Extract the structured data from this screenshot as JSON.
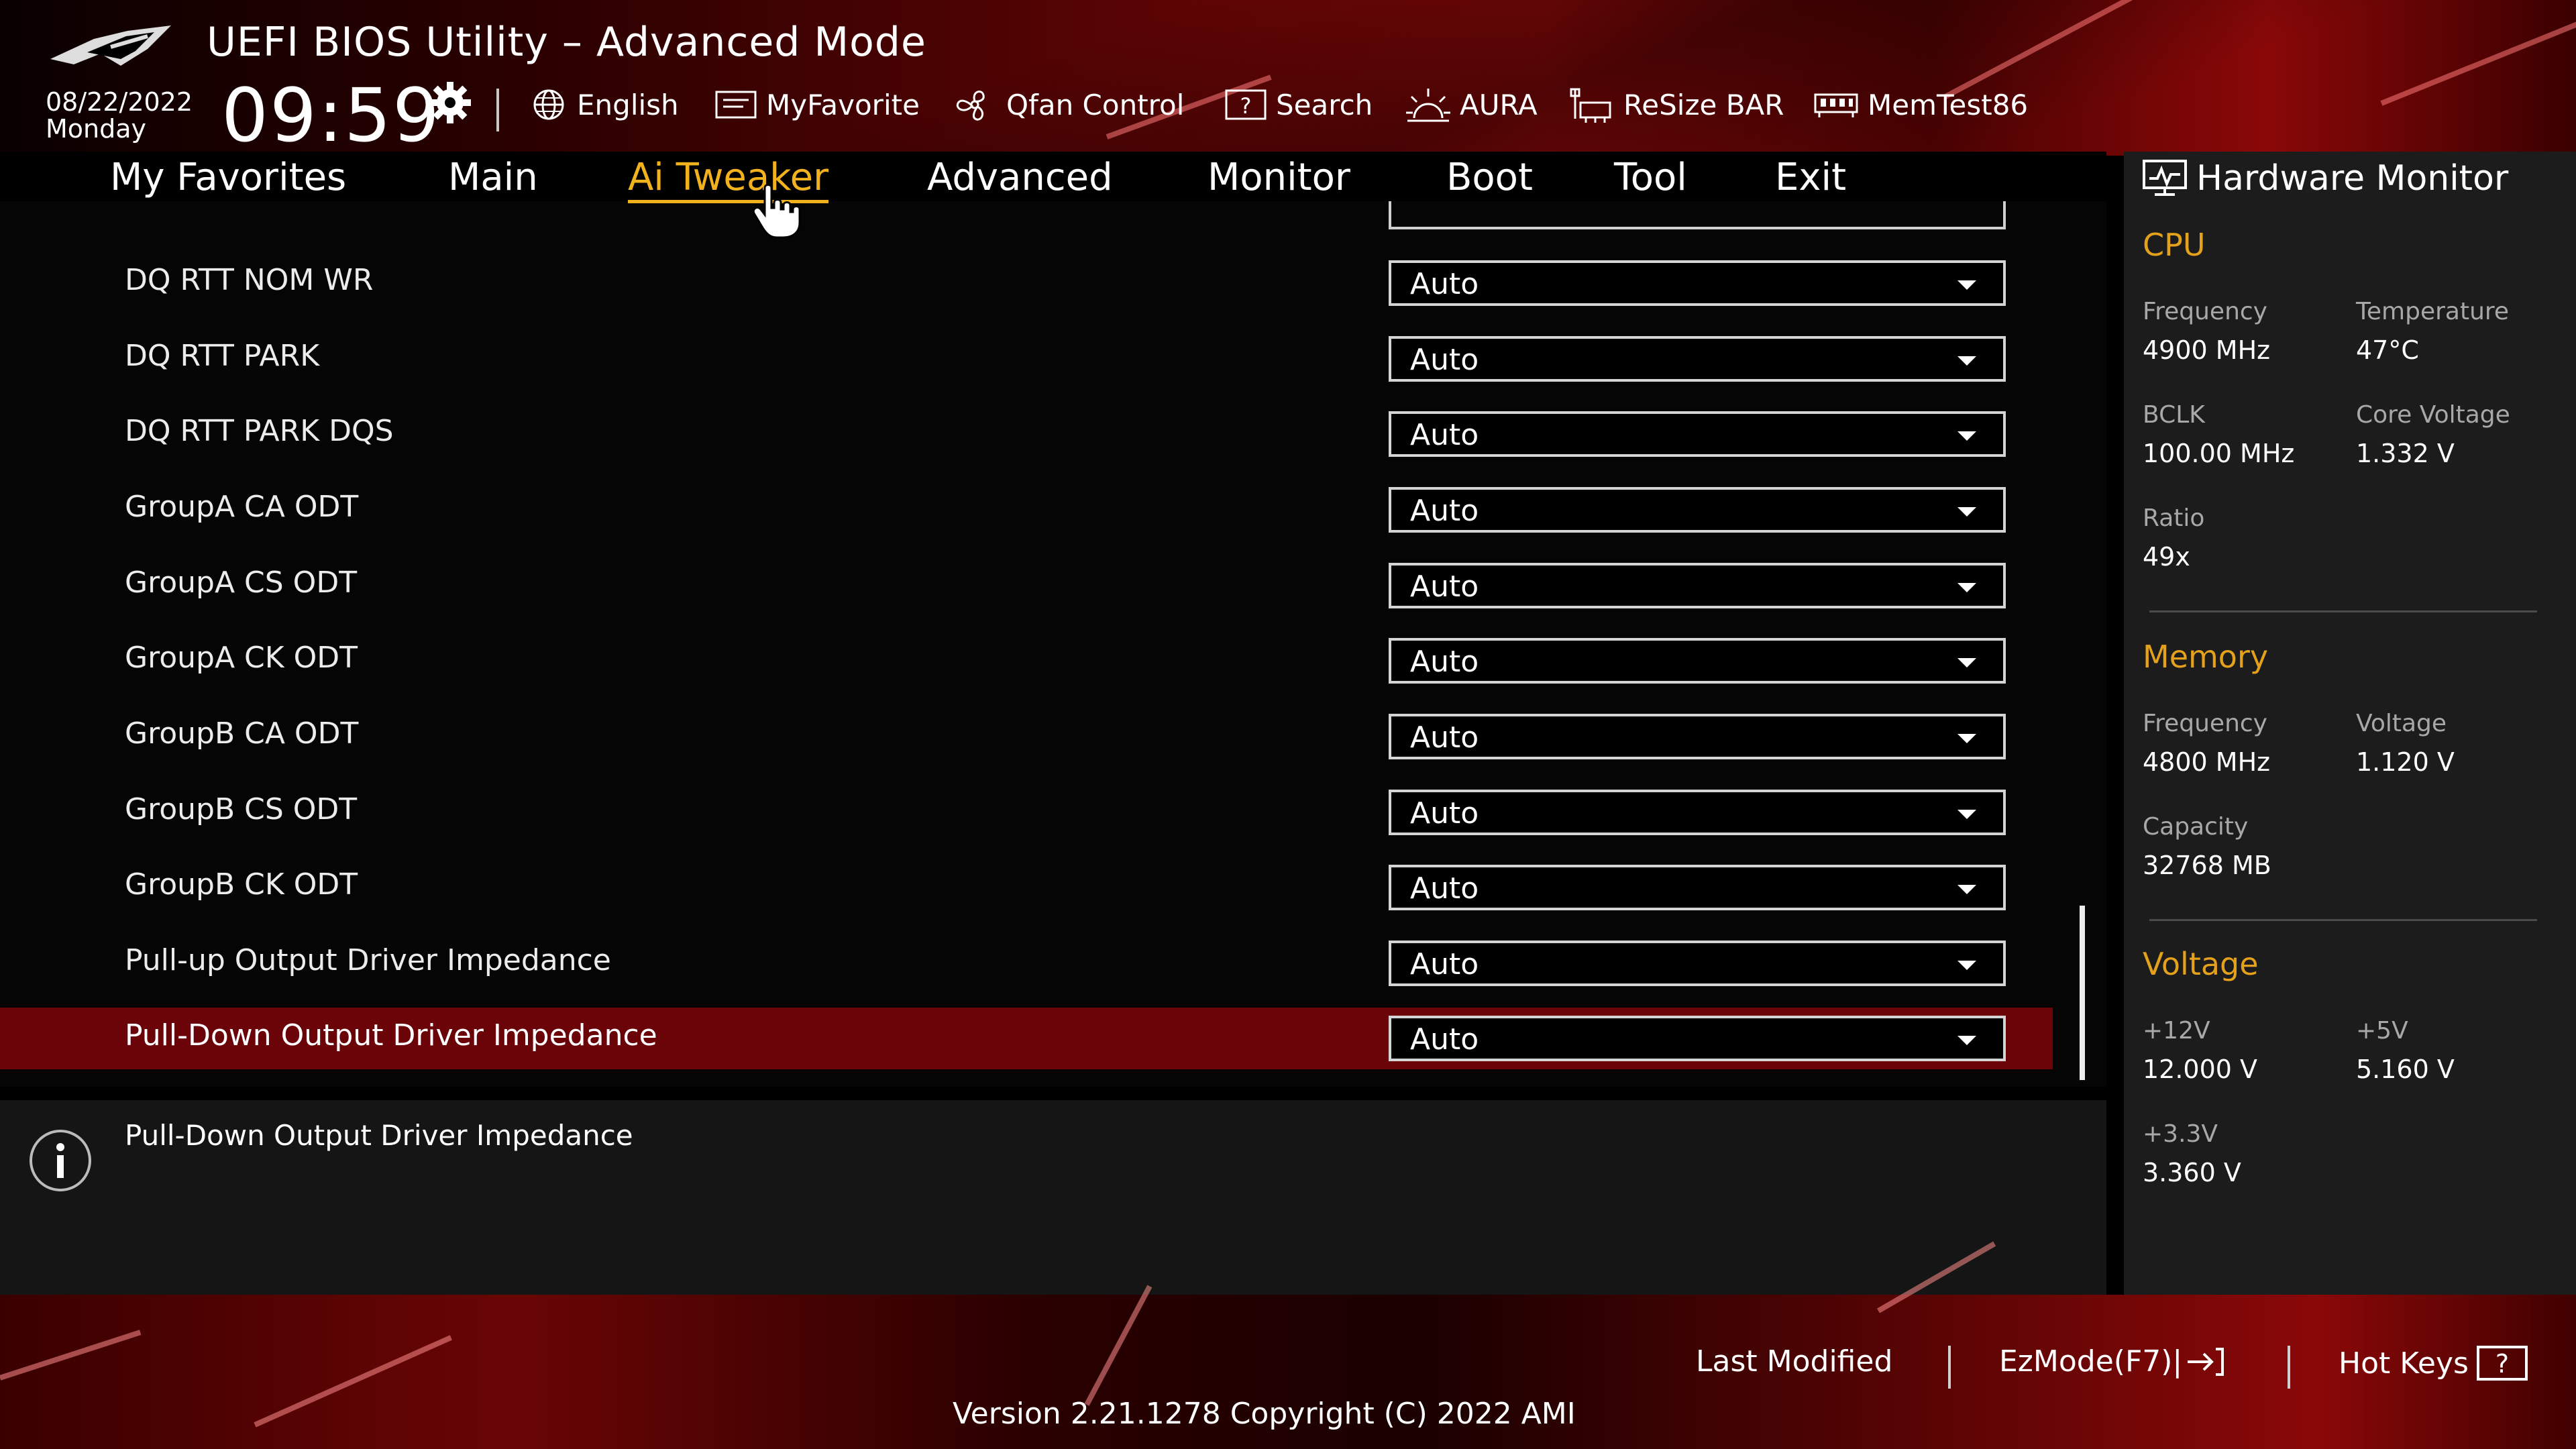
{
  "header": {
    "title": "UEFI BIOS Utility – Advanced Mode",
    "date": "08/22/2022",
    "day": "Monday",
    "time": "09:59",
    "tools": [
      {
        "label": "English",
        "icon": "globe-icon"
      },
      {
        "label": "MyFavorite",
        "icon": "favorite-icon"
      },
      {
        "label": "Qfan Control",
        "icon": "fan-icon"
      },
      {
        "label": "Search",
        "icon": "search-icon"
      },
      {
        "label": "AURA",
        "icon": "aura-icon"
      },
      {
        "label": "ReSize BAR",
        "icon": "resize-bar-icon"
      },
      {
        "label": "MemTest86",
        "icon": "memory-icon"
      }
    ]
  },
  "nav": {
    "tabs": [
      {
        "label": "My Favorites"
      },
      {
        "label": "Main"
      },
      {
        "label": "Ai Tweaker",
        "active": true
      },
      {
        "label": "Advanced"
      },
      {
        "label": "Monitor"
      },
      {
        "label": "Boot"
      },
      {
        "label": "Tool"
      },
      {
        "label": "Exit"
      }
    ]
  },
  "settings": [
    {
      "label": "DQ RTT NOM WR",
      "value": "Auto"
    },
    {
      "label": "DQ RTT PARK",
      "value": "Auto"
    },
    {
      "label": "DQ RTT PARK DQS",
      "value": "Auto"
    },
    {
      "label": "GroupA CA ODT",
      "value": "Auto"
    },
    {
      "label": "GroupA CS ODT",
      "value": "Auto"
    },
    {
      "label": "GroupA CK ODT",
      "value": "Auto"
    },
    {
      "label": "GroupB CA ODT",
      "value": "Auto"
    },
    {
      "label": "GroupB CS ODT",
      "value": "Auto"
    },
    {
      "label": "GroupB CK ODT",
      "value": "Auto"
    },
    {
      "label": "Pull-up Output Driver Impedance",
      "value": "Auto"
    },
    {
      "label": "Pull-Down Output Driver Impedance",
      "value": "Auto",
      "selected": true
    }
  ],
  "help": {
    "text": "Pull-Down Output Driver Impedance"
  },
  "hardware_monitor": {
    "title": "Hardware Monitor",
    "cpu": {
      "heading": "CPU",
      "frequency_label": "Frequency",
      "frequency": "4900 MHz",
      "temperature_label": "Temperature",
      "temperature": "47°C",
      "bclk_label": "BCLK",
      "bclk": "100.00 MHz",
      "core_voltage_label": "Core Voltage",
      "core_voltage": "1.332 V",
      "ratio_label": "Ratio",
      "ratio": "49x"
    },
    "memory": {
      "heading": "Memory",
      "frequency_label": "Frequency",
      "frequency": "4800 MHz",
      "voltage_label": "Voltage",
      "voltage": "1.120 V",
      "capacity_label": "Capacity",
      "capacity": "32768 MB"
    },
    "voltage": {
      "heading": "Voltage",
      "v12_label": "+12V",
      "v12": "12.000 V",
      "v5_label": "+5V",
      "v5": "5.160 V",
      "v33_label": "+3.3V",
      "v33": "3.360 V"
    }
  },
  "footer": {
    "last_modified": "Last Modified",
    "ezmode": "EzMode(F7)|",
    "hot_keys": "Hot Keys",
    "version": "Version 2.21.1278 Copyright (C) 2022 AMI"
  },
  "colors": {
    "accent": "#f2b21e",
    "section_heading": "#e4a11b",
    "selected_row": "#6a0408"
  }
}
